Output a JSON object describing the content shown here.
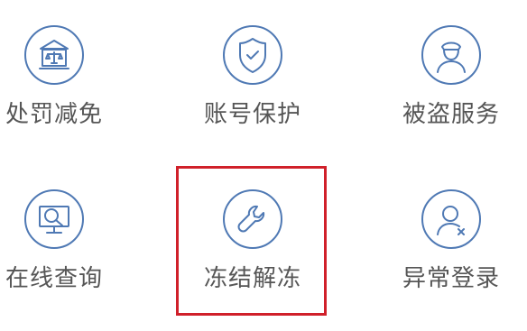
{
  "grid": {
    "items": [
      {
        "label": "处罚减免",
        "icon": "courthouse-scales-icon"
      },
      {
        "label": "账号保护",
        "icon": "shield-check-icon"
      },
      {
        "label": "被盗服务",
        "icon": "police-officer-icon"
      },
      {
        "label": "在线查询",
        "icon": "monitor-magnifier-icon"
      },
      {
        "label": "冻结解冻",
        "icon": "wrench-icon"
      },
      {
        "label": "异常登录",
        "icon": "user-warning-icon"
      }
    ],
    "selected_label": "冻结解冻"
  },
  "colors": {
    "icon_stroke": "#4f79b4",
    "label_text": "#565656",
    "highlight": "#d0202a"
  }
}
